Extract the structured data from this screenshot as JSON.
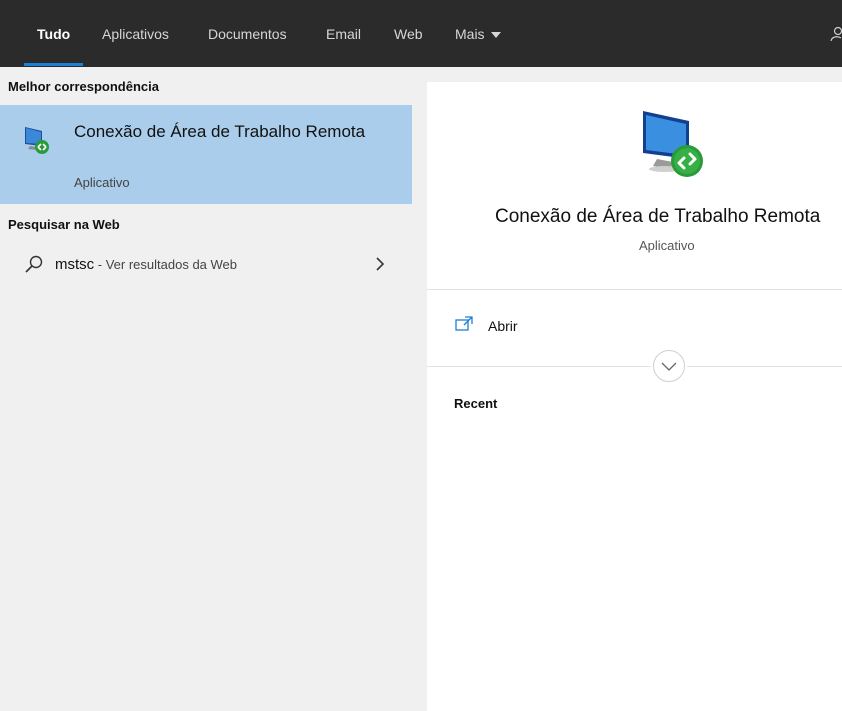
{
  "nav": {
    "tabs": [
      {
        "label": "Tudo",
        "active": true
      },
      {
        "label": "Aplicativos"
      },
      {
        "label": "Documentos"
      },
      {
        "label": "Email"
      },
      {
        "label": "Web"
      },
      {
        "label": "Mais"
      }
    ],
    "mais_icon": "caret-down-icon",
    "right_icon": "person-icon"
  },
  "results": {
    "best_match_header": "Melhor correspondência",
    "best_match": {
      "title": "Conexão de Área de Trabalho Remota",
      "subtitle": "Aplicativo",
      "icon": "remote-desktop-icon"
    },
    "web_header": "Pesquisar na Web",
    "web_item": {
      "query": "mstsc",
      "suffix": " - Ver resultados da Web",
      "icon": "search-icon",
      "chevron": "chevron-right-icon"
    }
  },
  "detail": {
    "title": "Conexão de Área de Trabalho Remota",
    "subtitle": "Aplicativo",
    "icon": "remote-desktop-icon",
    "actions": [
      {
        "label": "Abrir",
        "icon": "open-icon"
      }
    ],
    "expand_icon": "chevron-down-icon",
    "recent_header": "Recent"
  },
  "colors": {
    "topbar": "#2b2b2b",
    "accent": "#1d7ed6",
    "selected": "#a9cdea",
    "panel": "#f0f0f0"
  }
}
